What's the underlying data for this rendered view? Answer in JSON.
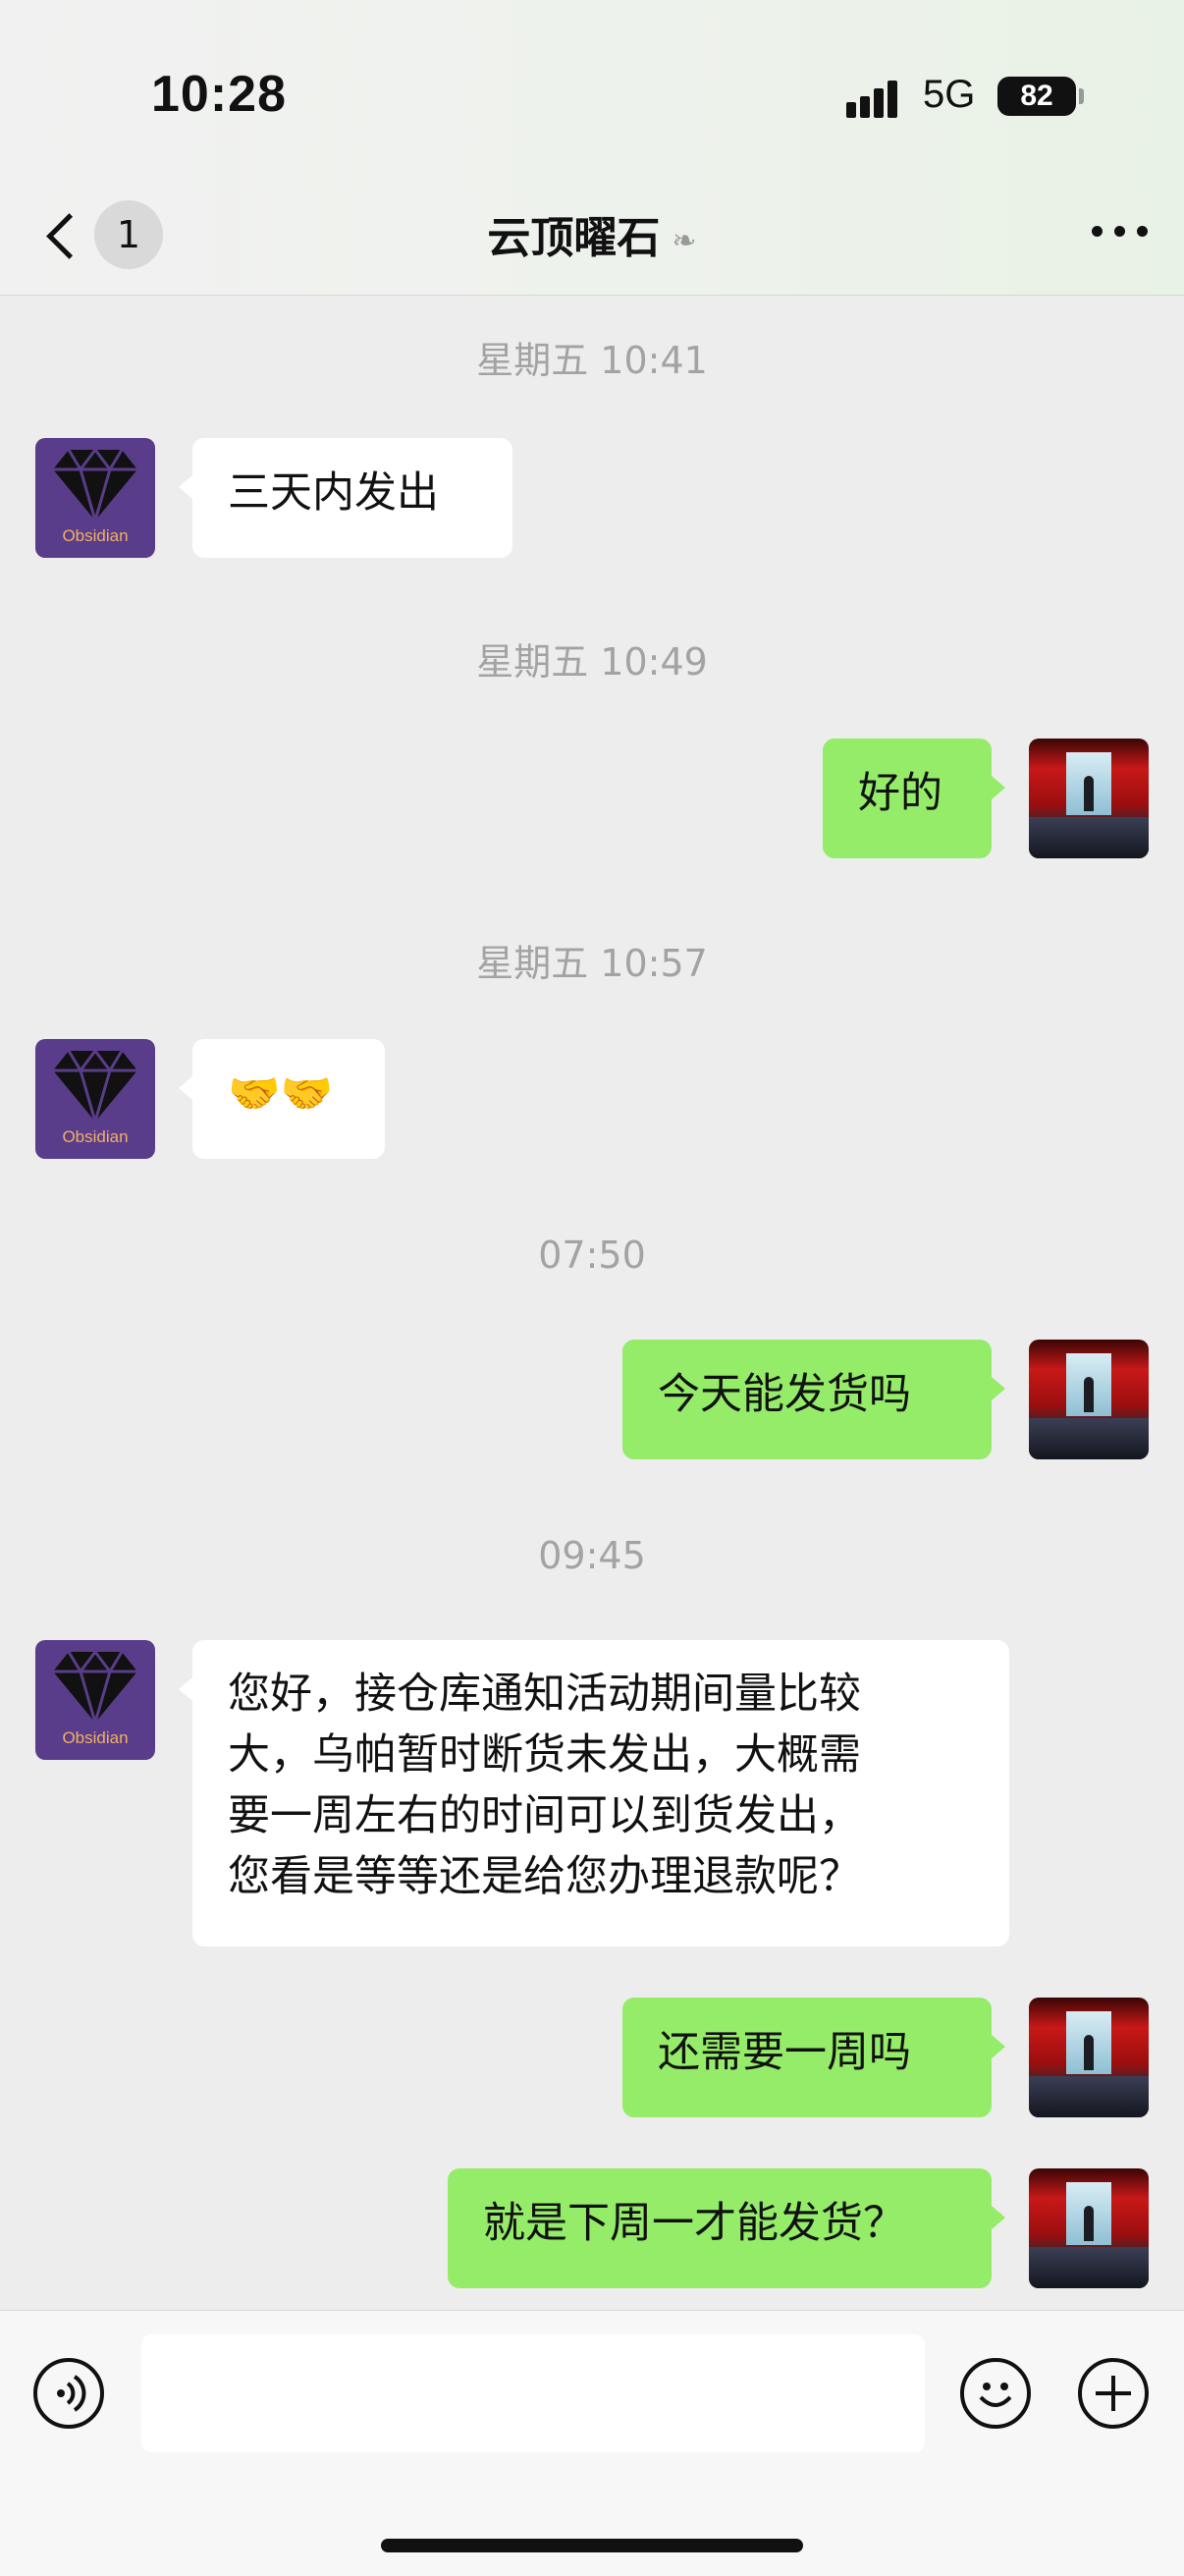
{
  "status_bar": {
    "time": "10:28",
    "network": "5G",
    "battery": "82"
  },
  "nav": {
    "unread_count": "1",
    "title": "云顶曜石"
  },
  "avatars": {
    "contact_label": "Obsidian"
  },
  "messages": [
    {
      "type": "timestamp",
      "text": "星期五 10:41"
    },
    {
      "type": "in",
      "text": "三天内发出"
    },
    {
      "type": "timestamp",
      "text": "星期五 10:49"
    },
    {
      "type": "out",
      "text": "好的"
    },
    {
      "type": "timestamp",
      "text": "星期五 10:57"
    },
    {
      "type": "in",
      "text": "🤝🤝"
    },
    {
      "type": "timestamp",
      "text": "07:50"
    },
    {
      "type": "out",
      "text": "今天能发货吗"
    },
    {
      "type": "timestamp",
      "text": "09:45"
    },
    {
      "type": "in",
      "lines": [
        "您好，接仓库通知活动期间量比较",
        "大，乌帕暂时断货未发出，大概需",
        "要一周左右的时间可以到货发出，",
        "您看是等等还是给您办理退款呢？"
      ]
    },
    {
      "type": "out",
      "text": "还需要一周吗"
    },
    {
      "type": "out",
      "text": "就是下周一才能发货？"
    }
  ],
  "colors": {
    "outgoing_bubble": "#95ec69",
    "incoming_bubble": "#ffffff",
    "background": "#ededed"
  }
}
